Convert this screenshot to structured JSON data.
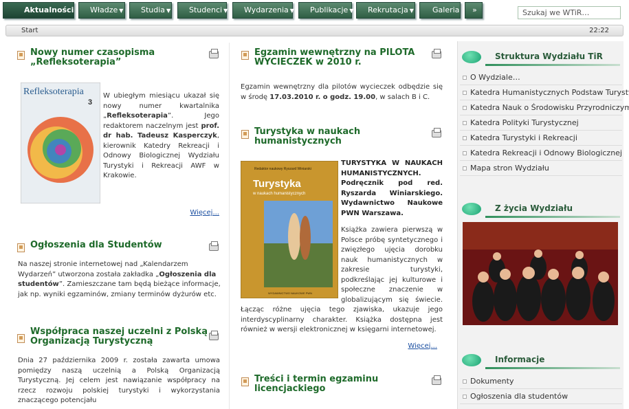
{
  "nav": {
    "items": [
      {
        "label": "Aktualności",
        "dropdown": false,
        "active": true
      },
      {
        "label": "Władze",
        "dropdown": true
      },
      {
        "label": "Studia",
        "dropdown": true
      },
      {
        "label": "Studenci",
        "dropdown": true
      },
      {
        "label": "Wydarzenia",
        "dropdown": true
      },
      {
        "label": "Publikacje",
        "dropdown": true
      },
      {
        "label": "Rekrutacja",
        "dropdown": true
      },
      {
        "label": "Galeria",
        "dropdown": false
      },
      {
        "label": "»",
        "dropdown": false
      }
    ],
    "search_placeholder": "Szukaj we WTiR…"
  },
  "breadcrumb": {
    "label": "Start",
    "time": "22:22"
  },
  "col1": [
    {
      "title": "Nowy numer czasopisma „Refleksoterapia”",
      "cover_title": "Refleksoterapia",
      "cover_issue": "3",
      "body_pre": "W ubiegłym miesiącu ukazał się nowy numer kwartalnika „",
      "body_b1": "Refleksoterapia",
      "body_mid1": "”. Jego redaktorem naczelnym jest ",
      "body_b2": "prof. dr hab. Tadeusz Kasperczyk",
      "body_post": ", kierownik Katedry Rekreacji i Odnowy Biologicznej Wydziału Turystyki i Rekreacji AWF w Krakowie.",
      "more": "Więcej..."
    },
    {
      "title": "Ogłoszenia dla Studentów",
      "body_pre": "Na naszej stronie internetowej nad „Kalendarzem Wydarzeń” utworzona została zakładka „",
      "body_b1": "Ogłoszenia dla studentów",
      "body_post": "”. Zamieszczane tam będą bieżące informacje, jak np. wyniki egzaminów, zmiany terminów dyżurów etc."
    },
    {
      "title": "Współpraca naszej uczelni z Polską Organizacją Turystyczną",
      "body": "Dnia 27 października 2009 r. została zawarta umowa pomiędzy naszą uczelnią a Polską Organizacją Turystyczną. Jej celem jest nawiązanie współpracy na rzecz rozwoju polskiej turystyki i wykorzystania znaczącego potencjału"
    }
  ],
  "col2": [
    {
      "title": "Egzamin wewnętrzny na PILOTA WYCIECZEK w 2010 r.",
      "body_pre": "Egzamin wewnętrzny dla pilotów wycieczek odbędzie się w środę ",
      "body_b1": "17.03.2010 r. o godz. 19.00",
      "body_post": ", w salach B i C."
    },
    {
      "title": "Turystyka w naukach humanistycznych",
      "book_editor": "Redaktor naukowy Ryszard Winiarski",
      "book_title_1": "Turystyka",
      "book_title_2": "w naukach humanistycznych",
      "book_publisher": "WYDAWNICTWO NAUKOWE PWN",
      "bold_lead": "TURYSTYKA W NAUKACH HUMANISTYCZNYCH. Podręcznik pod red. Ryszarda Winiarskiego. Wydawnictwo Naukowe PWN Warszawa.",
      "body": "Książka zawiera pierwszą w Polsce próbę syntetycznego i zwięzłego ujęcia dorobku nauk humanistycznych w zakresie turystyki, podkreślając jej kulturowe i społeczne znaczenie w globalizującym się świecie. Łącząc różne ujęcia tego zjawiska, ukazuje jego interdyscyplinarny charakter. Książka dostępna jest również w wersji elektronicznej w księgarni internetowej.",
      "more": "Więcej..."
    },
    {
      "title": "Treści i termin egzaminu licencjackiego"
    }
  ],
  "sidebar": {
    "structure_title": "Struktura Wydziału TiR",
    "structure_items": [
      "O Wydziale…",
      "Katedra Humanistycznych Podstaw Turystyki",
      "Katedra Nauk o Środowisku Przyrodniczym",
      "Katedra Polityki Turystycznej",
      "Katedra Turystyki i Rekreacji",
      "Katedra Rekreacji i Odnowy Biologicznej",
      "Mapa stron Wydziału"
    ],
    "life_title": "Z życia Wydziału",
    "info_title": "Informacje",
    "info_items": [
      "Dokumenty",
      "Ogłoszenia dla studentów"
    ]
  },
  "colors": {
    "nav_green": "#3a6a52",
    "title_green": "#1e6a2a",
    "accent_oval": "#1ca373"
  }
}
